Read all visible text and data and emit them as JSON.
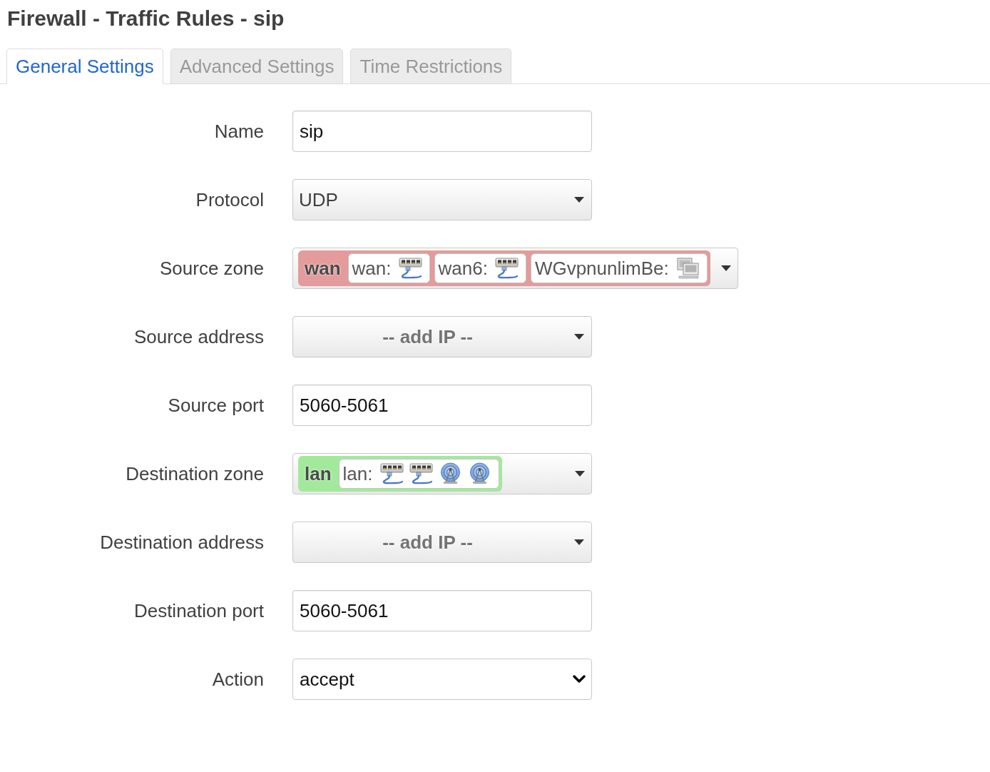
{
  "page_title": "Firewall - Traffic Rules - sip",
  "tabs": [
    {
      "label": "General Settings",
      "selected": true
    },
    {
      "label": "Advanced Settings",
      "selected": false
    },
    {
      "label": "Time Restrictions",
      "selected": false
    }
  ],
  "fields": [
    {
      "label": "Name",
      "kind": "text",
      "value": "sip"
    },
    {
      "label": "Protocol",
      "kind": "dropdown",
      "value": "UDP"
    },
    {
      "label": "Source zone",
      "kind": "zone",
      "zone": {
        "name": "wan",
        "color": "#e39b9b",
        "networks": [
          {
            "label": "wan:",
            "devices": [
              {
                "kind": "ethernet"
              }
            ]
          },
          {
            "label": "wan6:",
            "devices": [
              {
                "kind": "ethernet"
              }
            ]
          },
          {
            "label": "WGvpnunlimBe:",
            "devices": [
              {
                "kind": "virtual"
              }
            ]
          }
        ]
      }
    },
    {
      "label": "Source address",
      "kind": "dropdown",
      "placeholder": "-- add IP --"
    },
    {
      "label": "Source port",
      "kind": "text",
      "value": "5060-5061"
    },
    {
      "label": "Destination zone",
      "kind": "zone",
      "zone": {
        "name": "lan",
        "color": "#a3e99d",
        "networks": [
          {
            "label": "lan:",
            "devices": [
              {
                "kind": "ethernet"
              },
              {
                "kind": "ethernet"
              },
              {
                "kind": "wireless"
              },
              {
                "kind": "wireless"
              }
            ]
          }
        ]
      }
    },
    {
      "label": "Destination address",
      "kind": "dropdown",
      "placeholder": "-- add IP --"
    },
    {
      "label": "Destination port",
      "kind": "text",
      "value": "5060-5061"
    },
    {
      "label": "Action",
      "kind": "select",
      "value": "accept"
    }
  ]
}
